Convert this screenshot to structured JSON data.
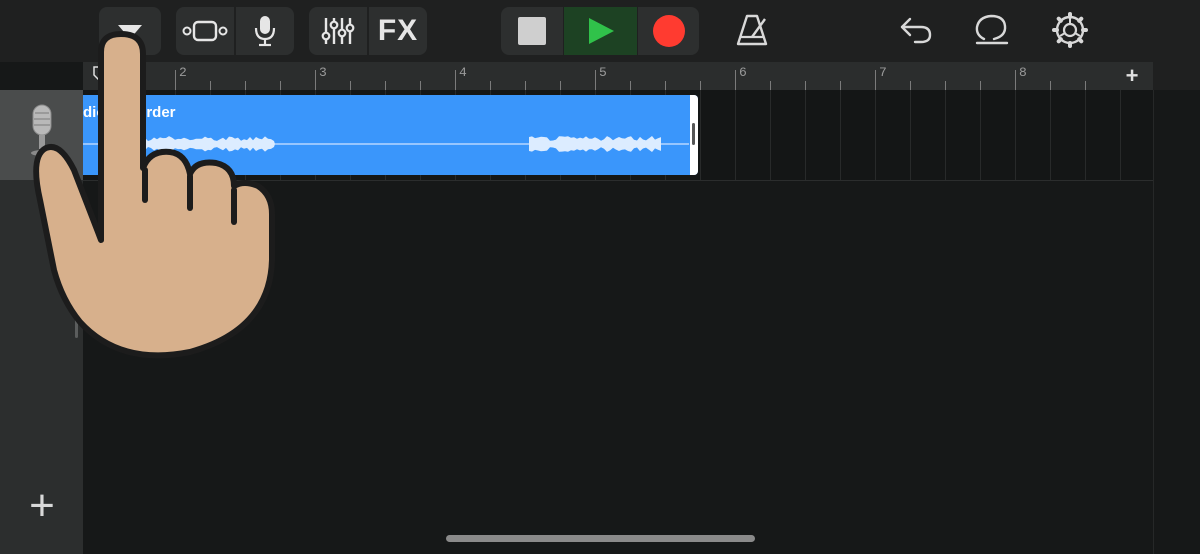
{
  "toolbar": {
    "tracks_view_icon": "tracks-view-icon",
    "browser_icon": "browser-icon",
    "smart_controls_icon": "microphone-icon",
    "mixer_icon": "mixer-icon",
    "fx_label": "FX",
    "stop_icon": "stop-icon",
    "play_icon": "play-icon",
    "record_icon": "record-icon",
    "metronome_icon": "metronome-icon",
    "undo_icon": "undo-icon",
    "loop_icon": "loop-icon",
    "settings_icon": "settings-icon"
  },
  "ruler": {
    "bars": [
      "2",
      "3",
      "4",
      "5",
      "6",
      "7",
      "8"
    ],
    "add_section_label": "+"
  },
  "track": {
    "instrument_icon": "microphone-icon",
    "region_title": "dio Recorder"
  },
  "add_track_label": "+",
  "colors": {
    "region": "#3a96fb",
    "play": "#30c24a",
    "record": "#ff3b30",
    "toolbar_bg": "#1f2020"
  }
}
